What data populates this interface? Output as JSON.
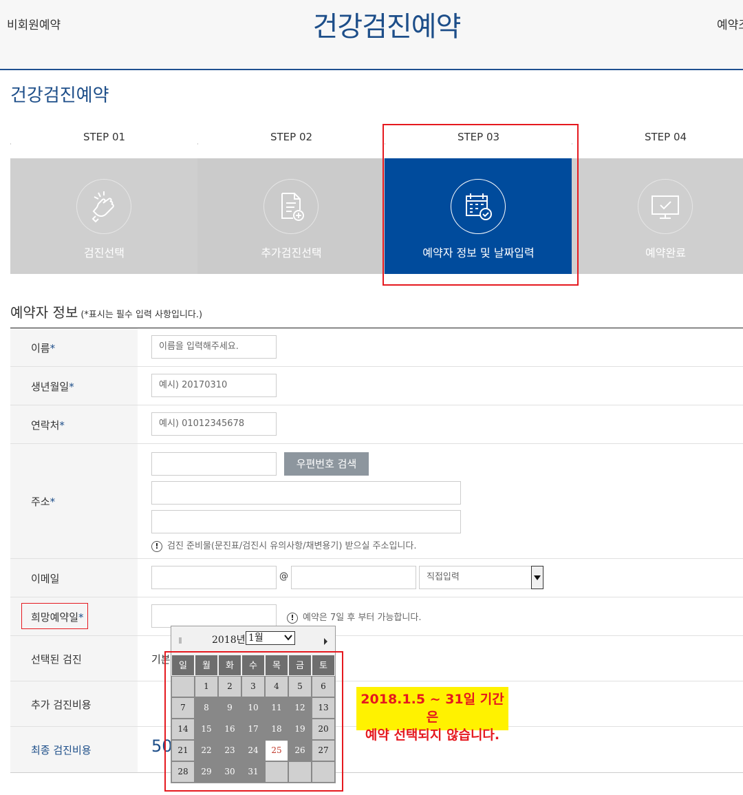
{
  "header": {
    "left_link": "비회원예약",
    "title": "건강검진예약",
    "right_link": "예약조"
  },
  "page_title": "건강검진예약",
  "steps": [
    {
      "step": "STEP 01",
      "label": "검진선택",
      "icon": "hand-tap-icon"
    },
    {
      "step": "STEP 02",
      "label": "추가검진선택",
      "icon": "document-add-icon"
    },
    {
      "step": "STEP 03",
      "label": "예약자 정보 및 날짜입력",
      "icon": "calendar-check-icon",
      "active": true
    },
    {
      "step": "STEP 04",
      "label": "예약완료",
      "icon": "monitor-check-icon"
    }
  ],
  "form": {
    "section_title": "예약자 정보",
    "section_note": "(*표시는 필수 입력 사항입니다.)",
    "required_mark": "*",
    "name_label": "이름",
    "name_placeholder": "이름을 입력해주세요.",
    "birth_label": "생년월일",
    "birth_placeholder": "예시) 20170310",
    "phone_label": "연락처",
    "phone_placeholder": "예시) 01012345678",
    "address_label": "주소",
    "zip_button": "우편번호 검색",
    "address_notice": "검진 준비물(문진표/검진시 유의사항/채변용기) 받으실 주소입니다.",
    "email_label": "이메일",
    "email_at": "@",
    "email_select": "직접입력",
    "hope_date_label": "희망예약일",
    "hope_date_notice": "예약은 7일 후 부터 가능합니다.",
    "selected_exam_label": "선택된 검진",
    "selected_exam_value": "기본",
    "extra_cost_label": "추가 검진비용",
    "final_cost_label": "최종 검진비용",
    "final_cost_value": "50"
  },
  "calendar": {
    "year": "2018년",
    "month": "1월",
    "weekdays": [
      "일",
      "월",
      "화",
      "수",
      "목",
      "금",
      "토"
    ],
    "weeks": [
      [
        {
          "d": "",
          "s": "empty"
        },
        {
          "d": "1",
          "s": "off"
        },
        {
          "d": "2",
          "s": "off"
        },
        {
          "d": "3",
          "s": "off"
        },
        {
          "d": "4",
          "s": "off"
        },
        {
          "d": "5",
          "s": "off"
        },
        {
          "d": "6",
          "s": "off"
        }
      ],
      [
        {
          "d": "7",
          "s": "off"
        },
        {
          "d": "8",
          "s": "dis"
        },
        {
          "d": "9",
          "s": "dis"
        },
        {
          "d": "10",
          "s": "dis"
        },
        {
          "d": "11",
          "s": "dis"
        },
        {
          "d": "12",
          "s": "dis"
        },
        {
          "d": "13",
          "s": "off"
        }
      ],
      [
        {
          "d": "14",
          "s": "off"
        },
        {
          "d": "15",
          "s": "dis"
        },
        {
          "d": "16",
          "s": "dis"
        },
        {
          "d": "17",
          "s": "dis"
        },
        {
          "d": "18",
          "s": "dis"
        },
        {
          "d": "19",
          "s": "dis"
        },
        {
          "d": "20",
          "s": "off"
        }
      ],
      [
        {
          "d": "21",
          "s": "off"
        },
        {
          "d": "22",
          "s": "dis"
        },
        {
          "d": "23",
          "s": "dis"
        },
        {
          "d": "24",
          "s": "dis"
        },
        {
          "d": "25",
          "s": "today"
        },
        {
          "d": "26",
          "s": "dis"
        },
        {
          "d": "27",
          "s": "off"
        }
      ],
      [
        {
          "d": "28",
          "s": "off"
        },
        {
          "d": "29",
          "s": "dis"
        },
        {
          "d": "30",
          "s": "dis"
        },
        {
          "d": "31",
          "s": "dis"
        },
        {
          "d": "",
          "s": "empty"
        },
        {
          "d": "",
          "s": "empty"
        },
        {
          "d": "",
          "s": "empty"
        }
      ]
    ]
  },
  "callout": {
    "line1": "2018.1.5 ~ 31일 기간은",
    "line2": "예약 선택되지 않습니다."
  },
  "colors": {
    "brand": "#1d4e89",
    "active_step": "#004b9c",
    "highlight": "#e5181e",
    "callout_bg": "#fff200"
  }
}
